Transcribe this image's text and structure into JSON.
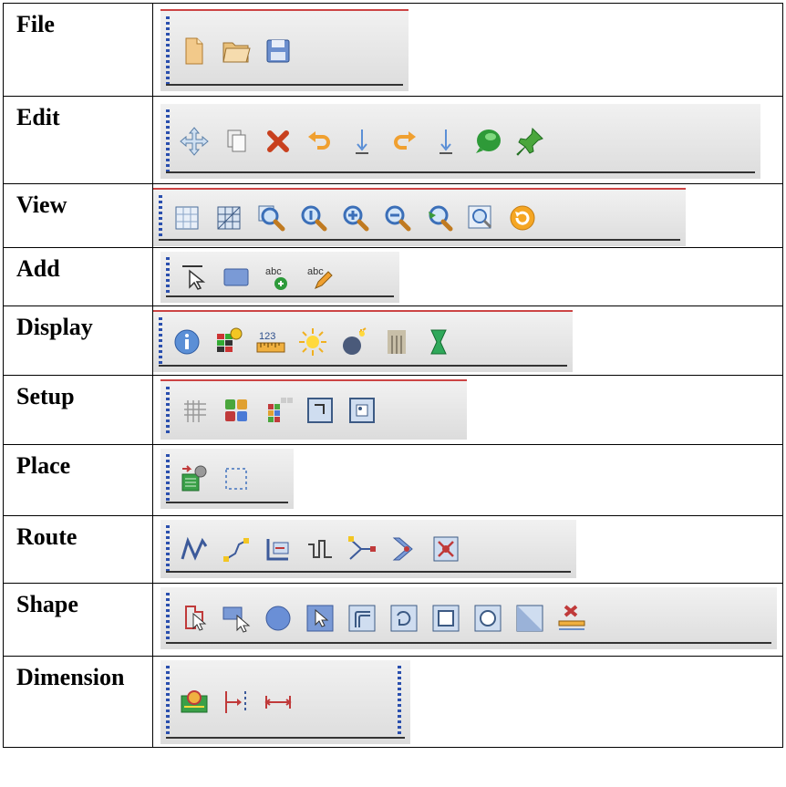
{
  "rows": [
    {
      "label": "File",
      "icons": [
        "new-file",
        "open-folder",
        "save"
      ]
    },
    {
      "label": "Edit",
      "icons": [
        "move",
        "copy",
        "delete",
        "undo",
        "undo-down",
        "redo",
        "redo-down",
        "green-ball",
        "pin"
      ]
    },
    {
      "label": "View",
      "icons": [
        "grid-view",
        "grid-view-2",
        "zoom-window",
        "zoom-fit",
        "zoom-in",
        "zoom-out",
        "zoom-previous",
        "zoom-selection",
        "refresh"
      ]
    },
    {
      "label": "Add",
      "icons": [
        "select-line",
        "rectangle",
        "add-text",
        "edit-text"
      ]
    },
    {
      "label": "Display",
      "icons": [
        "info",
        "element-info",
        "ruler",
        "sun",
        "bomb",
        "comb",
        "hourglass"
      ]
    },
    {
      "label": "Setup",
      "icons": [
        "grid",
        "color-palette",
        "layers",
        "frame",
        "frame-dot"
      ]
    },
    {
      "label": "Place",
      "icons": [
        "place-component",
        "dashed-box"
      ]
    },
    {
      "label": "Route",
      "icons": [
        "route-wave",
        "route-line",
        "route-bend",
        "route-step",
        "route-fork",
        "route-chevron",
        "route-box"
      ]
    },
    {
      "label": "Shape",
      "icons": [
        "shape-select",
        "shape-box-select",
        "circle",
        "select-square",
        "rounded-square",
        "rotate-square",
        "square",
        "circle-square",
        "shade-square",
        "delete-bar"
      ]
    },
    {
      "label": "Dimension",
      "icons": [
        "dimension-board",
        "dimension-left",
        "dimension-both"
      ]
    }
  ]
}
